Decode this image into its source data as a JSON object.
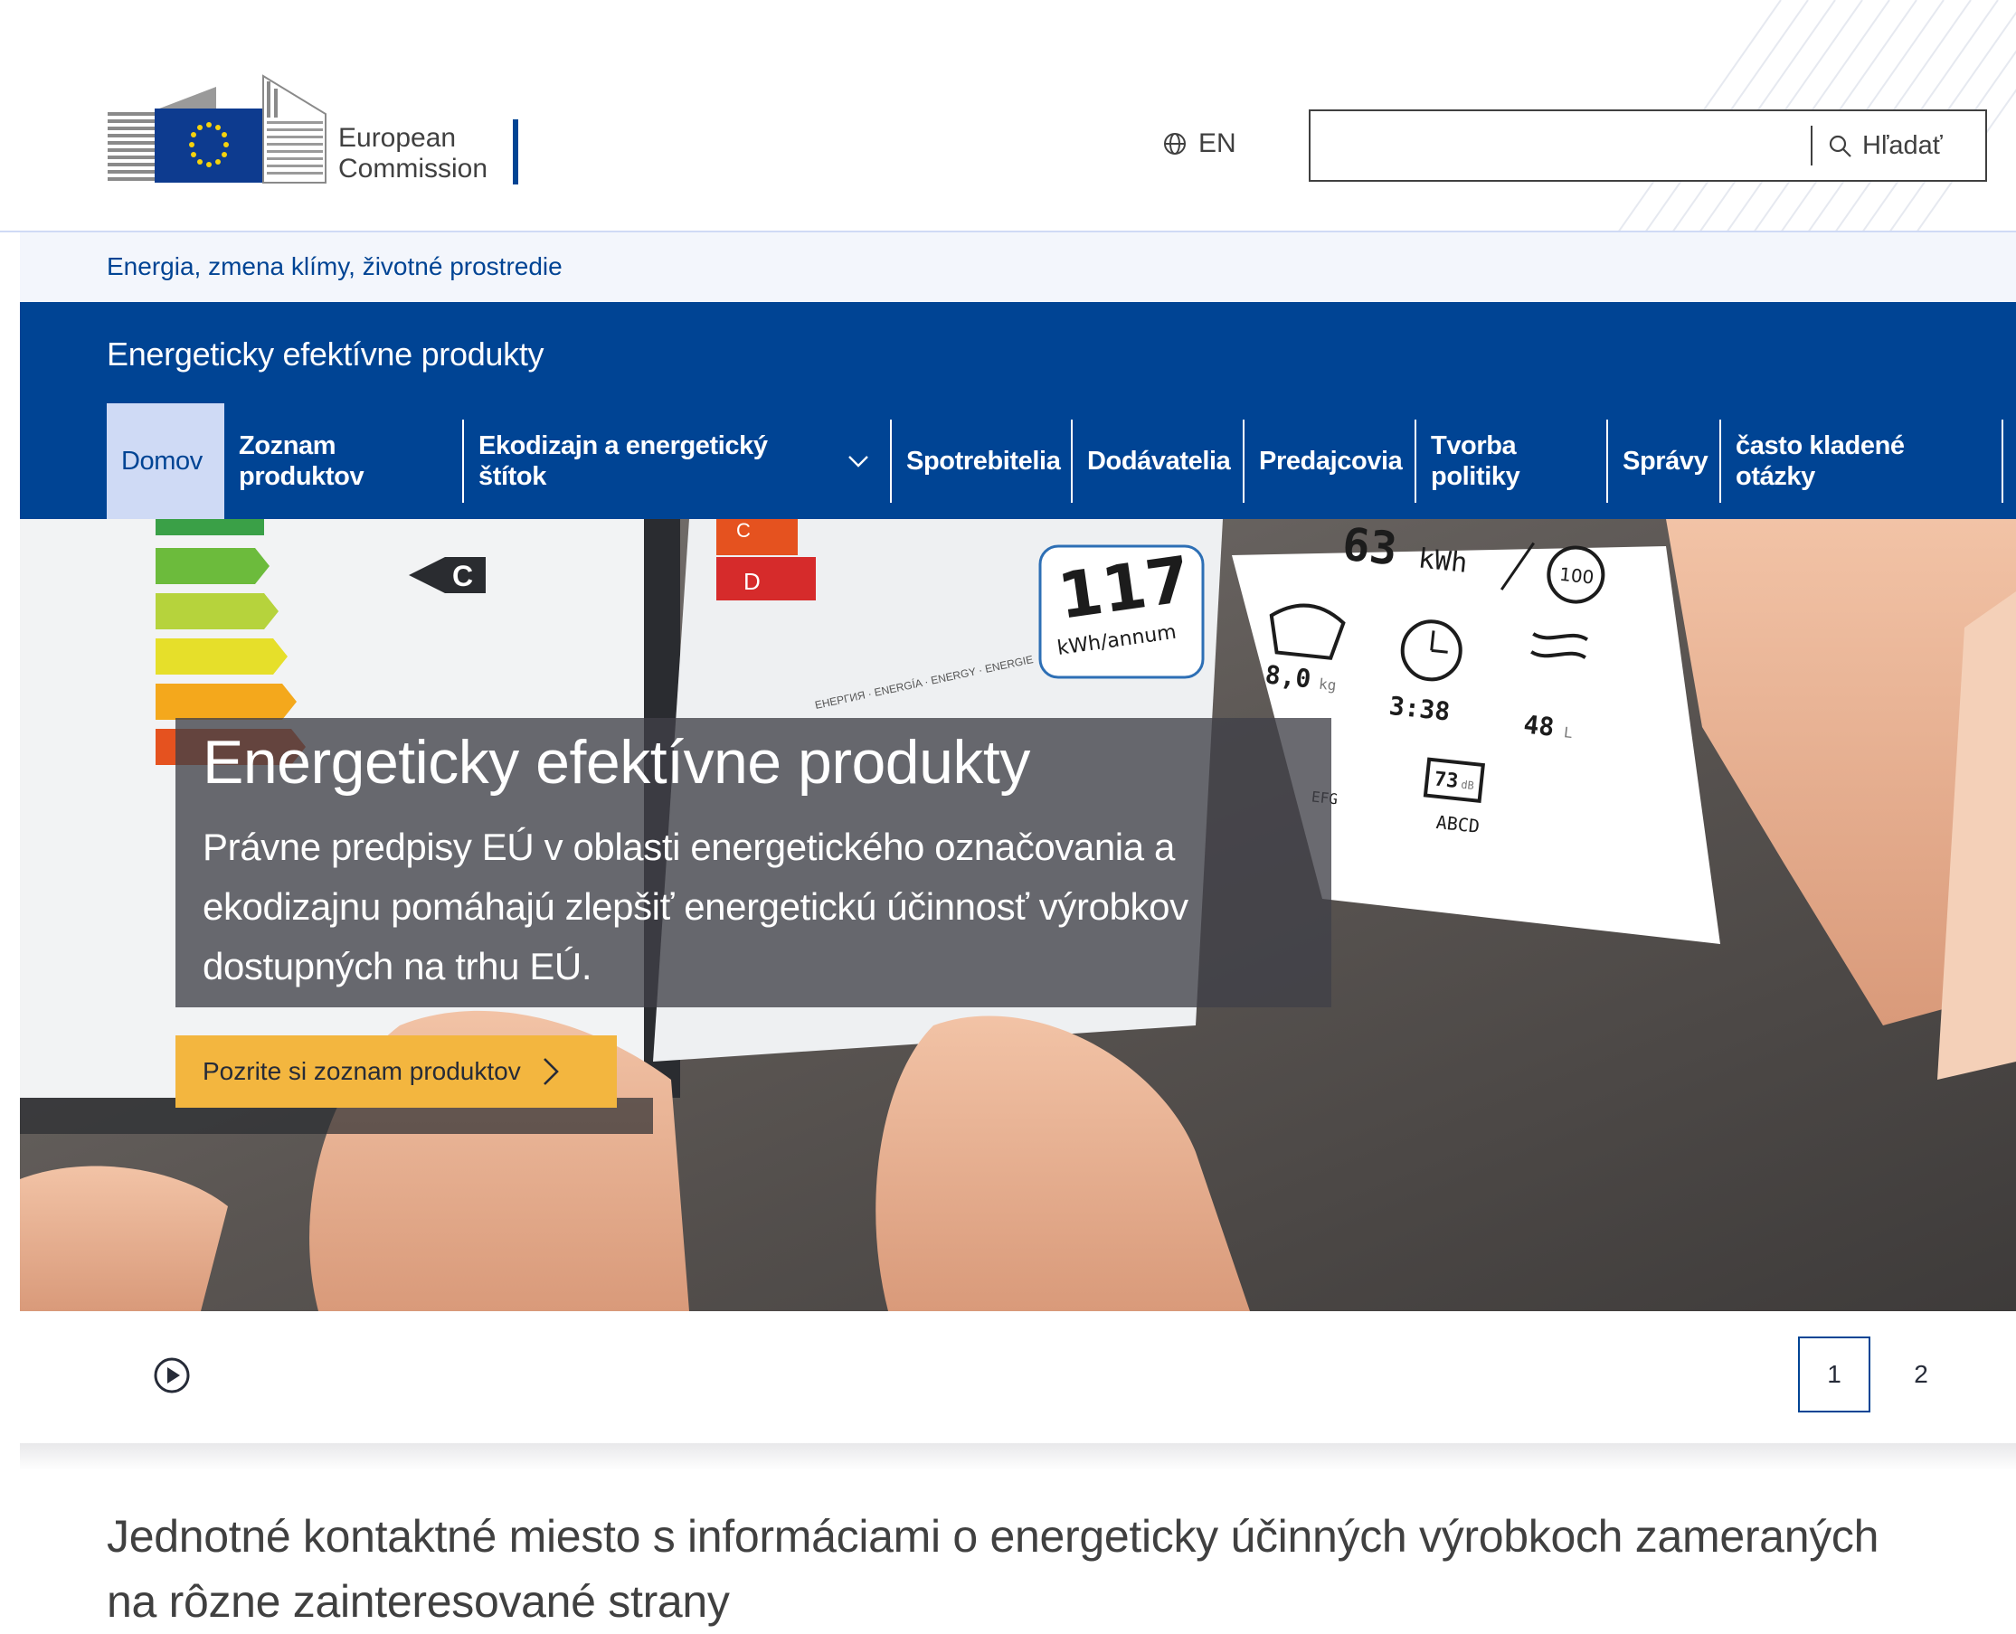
{
  "header": {
    "logo_line1": "European",
    "logo_line2": "Commission",
    "language": "EN",
    "language_icon": "globe-icon",
    "search_placeholder": "",
    "search_label": "Hľadať",
    "search_icon": "search-icon"
  },
  "site": {
    "parent_link": "Energia, zmena klímy, životné prostredie",
    "name": "Energeticky efektívne produkty"
  },
  "nav": {
    "items": [
      {
        "line1": "Domov",
        "line2": ""
      },
      {
        "line1": "Zoznam",
        "line2": "produktov"
      },
      {
        "line1": "Ekodizajn a energetický",
        "line2": "štítok"
      },
      {
        "line1": "Spotrebitelia",
        "line2": ""
      },
      {
        "line1": "Dodávatelia",
        "line2": ""
      },
      {
        "line1": "Predajcovia",
        "line2": ""
      },
      {
        "line1": "Tvorba",
        "line2": "politiky"
      },
      {
        "line1": "Správy",
        "line2": ""
      },
      {
        "line1": "často kladené",
        "line2": "otázky"
      }
    ]
  },
  "hero": {
    "title": "Energeticky efektívne produkty",
    "text": "Právne predpisy EÚ v oblasti energetického označovania a ekodizajnu pomáhajú zlepšiť energetickú účinnosť výrobkov dostupných na trhu EÚ.",
    "cta": "Pozrite si zoznam produktov",
    "label_values": {
      "class_c": "C",
      "class_d": "D",
      "annual": "117",
      "annual_unit": "kWh/annum",
      "kwh": "63",
      "kwh_unit": "kWh",
      "cycles": "100",
      "weight": "8,0",
      "weight_unit": "kg",
      "duration": "3:38",
      "water": "48",
      "water_unit": "L",
      "noise": "73",
      "noise_unit": "dB",
      "noise_class": "ABCD",
      "spin": "EFG",
      "energy_words": "ЕНЕРГИЯ · ENERGÍA · ENERGY · ENERGIE"
    }
  },
  "carousel": {
    "play_icon": "play-icon",
    "pages": [
      "1",
      "2"
    ],
    "current_page": "1"
  },
  "intro": {
    "text": "Jednotné kontaktné miesto s informáciami o energeticky účinných výrobkoch zameraných na rôzne zainteresované strany"
  },
  "colors": {
    "primary": "#004494",
    "accent": "#f3b63f",
    "active_nav": "#cfdaf5",
    "strip": "#f3f6fc"
  }
}
